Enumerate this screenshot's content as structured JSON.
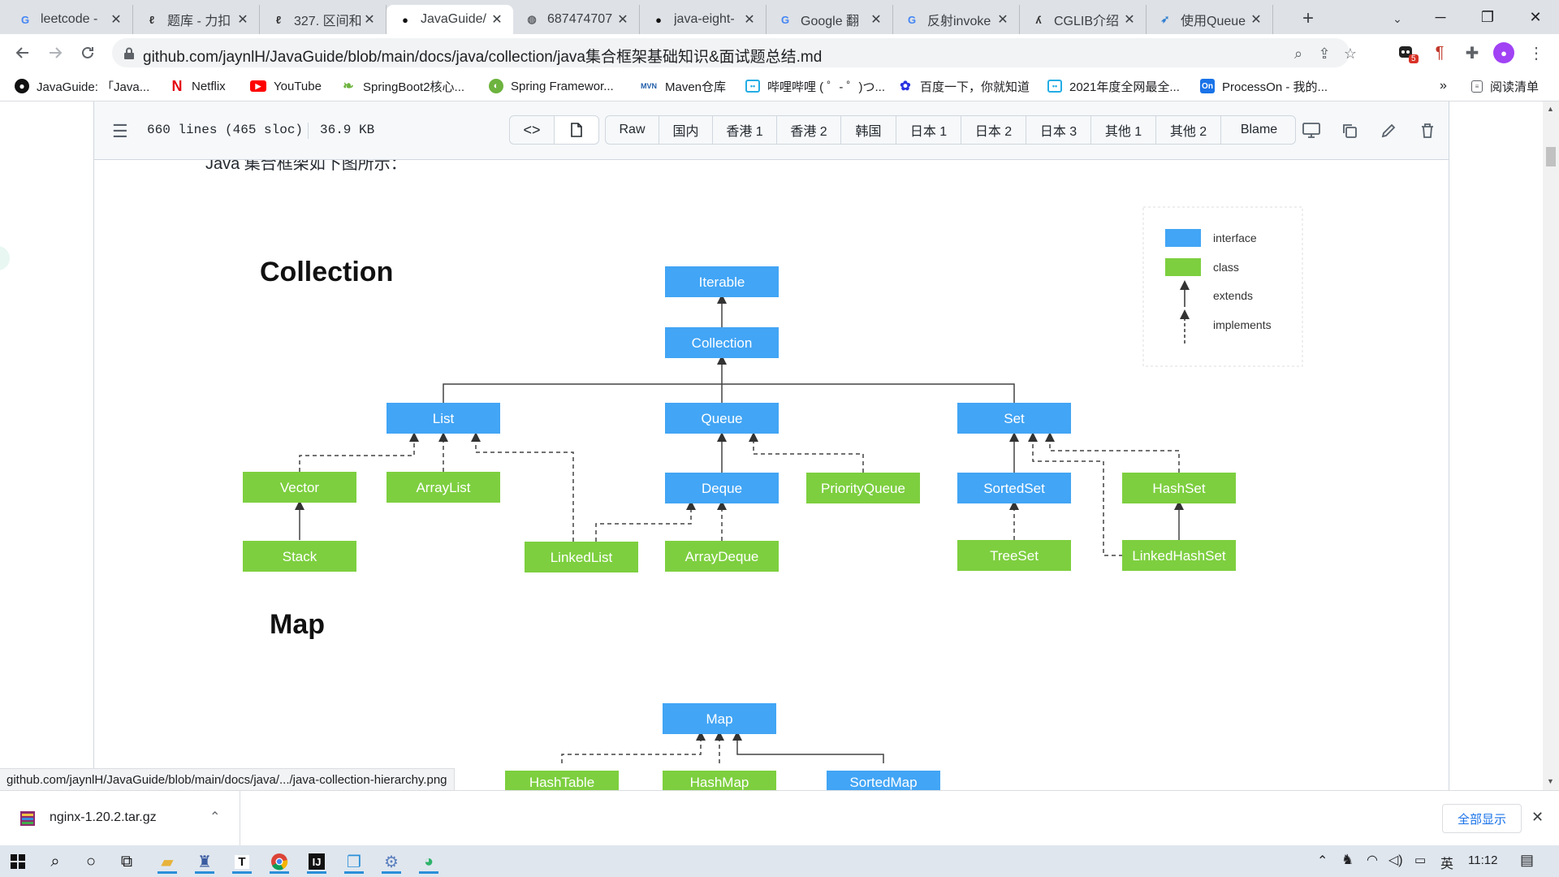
{
  "tabs": [
    {
      "title": "leetcode -",
      "icon": "google-icon",
      "icon_char": "G",
      "icon_color": "#4285f4"
    },
    {
      "title": "题库 - 力扣",
      "icon": "leetcode-icon",
      "icon_char": "ℓ",
      "icon_color": "#333333"
    },
    {
      "title": "327. 区间和",
      "icon": "leetcode-icon",
      "icon_char": "ℓ",
      "icon_color": "#333333"
    },
    {
      "title": "JavaGuide/",
      "icon": "github-icon",
      "icon_char": "●",
      "icon_color": "#111111",
      "active": true
    },
    {
      "title": "687474707",
      "icon": "globe-icon",
      "icon_char": "◍",
      "icon_color": "#5f6368"
    },
    {
      "title": "java-eight-",
      "icon": "github-icon",
      "icon_char": "●",
      "icon_color": "#111111"
    },
    {
      "title": "Google 翻",
      "icon": "google-translate-icon",
      "icon_char": "G",
      "icon_color": "#4285f4"
    },
    {
      "title": "反射invoke",
      "icon": "google-icon",
      "icon_char": "G",
      "icon_color": "#4285f4"
    },
    {
      "title": "CGLIB介绍",
      "icon": "cglib-icon",
      "icon_char": "ʎ",
      "icon_color": "#333333"
    },
    {
      "title": "使用Queue",
      "icon": "rocket-icon",
      "icon_char": "➶",
      "icon_color": "#2f7fd1"
    }
  ],
  "toolbar": {
    "url": "github.com/jaynlH/JavaGuide/blob/main/docs/java/collection/java集合框架基础知识&面试题总结.md",
    "extension_badge": "5"
  },
  "bookmarks": [
    {
      "label": "JavaGuide: 「Java...",
      "icon": "github-icon"
    },
    {
      "label": "Netflix",
      "icon": "netflix-icon"
    },
    {
      "label": "YouTube",
      "icon": "youtube-icon"
    },
    {
      "label": "SpringBoot2核心...",
      "icon": "spring-icon"
    },
    {
      "label": "Spring Framewor...",
      "icon": "spring-icon"
    },
    {
      "label": "Maven仓库",
      "icon": "maven-icon"
    },
    {
      "label": "哔哩哔哩 ( ゜- ゜)つ...",
      "icon": "bilibili-icon"
    },
    {
      "label": "百度一下，你就知道",
      "icon": "baidu-icon"
    },
    {
      "label": "2021年度全网最全...",
      "icon": "bilibili-icon"
    },
    {
      "label": "ProcessOn - 我的...",
      "icon": "processon-icon"
    }
  ],
  "reading_list": "阅读清单",
  "file_header": {
    "lines": "660 lines (465 sloc)",
    "size": "36.9 KB",
    "mirror_buttons": [
      "Raw",
      "国内",
      "香港 1",
      "香港 2",
      "韩国",
      "日本 1",
      "日本 2",
      "日本 3",
      "其他 1",
      "其他 2",
      "Blame"
    ]
  },
  "page_text": {
    "intro_partial": "Java 集合框架如下图所示："
  },
  "diagram": {
    "collection_title": "Collection",
    "map_title": "Map",
    "colors": {
      "interface": "#42a5f5",
      "class": "#7dcf3f"
    },
    "legend": {
      "interface": "interface",
      "class": "class",
      "extends": "extends",
      "implements": "implements"
    },
    "nodes": {
      "iterable": "Iterable",
      "collection": "Collection",
      "list": "List",
      "queue": "Queue",
      "set": "Set",
      "vector": "Vector",
      "arraylist": "ArrayList",
      "deque": "Deque",
      "priorityqueue": "PriorityQueue",
      "sortedset": "SortedSet",
      "hashset": "HashSet",
      "stack": "Stack",
      "linkedlist": "LinkedList",
      "arraydeque": "ArrayDeque",
      "treeset": "TreeSet",
      "linkedhashset": "LinkedHashSet",
      "map": "Map",
      "hashtable": "HashTable",
      "hashmap": "HashMap",
      "sortedmap": "SortedMap"
    }
  },
  "status_url": "github.com/jaynlH/JavaGuide/blob/main/docs/java/.../java-collection-hierarchy.png",
  "download": {
    "filename": "nginx-1.20.2.tar.gz",
    "show_all": "全部显示"
  },
  "taskbar": {
    "ime": "英",
    "time": "11:12"
  }
}
